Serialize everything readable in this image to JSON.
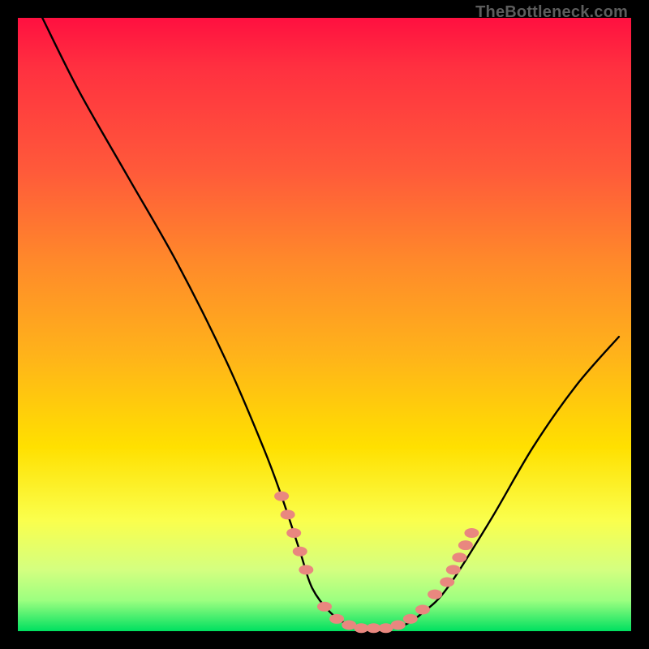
{
  "watermark": "TheBottleneck.com",
  "chart_data": {
    "type": "line",
    "title": "",
    "xlabel": "",
    "ylabel": "",
    "xlim": [
      0,
      100
    ],
    "ylim": [
      0,
      100
    ],
    "series": [
      {
        "name": "curve",
        "x": [
          4,
          10,
          18,
          26,
          34,
          40,
          43,
          46,
          48,
          51,
          54,
          57,
          60,
          63,
          66,
          70,
          77,
          84,
          91,
          98
        ],
        "y": [
          100,
          88,
          74,
          60,
          44,
          30,
          22,
          13,
          7,
          3,
          1,
          0.5,
          0.5,
          1,
          3,
          7,
          18,
          30,
          40,
          48
        ]
      }
    ],
    "markers": [
      {
        "name": "highlight-dots",
        "color": "#e9877f",
        "points": [
          {
            "x": 43,
            "y": 22
          },
          {
            "x": 44,
            "y": 19
          },
          {
            "x": 45,
            "y": 16
          },
          {
            "x": 46,
            "y": 13
          },
          {
            "x": 47,
            "y": 10
          },
          {
            "x": 50,
            "y": 4
          },
          {
            "x": 52,
            "y": 2
          },
          {
            "x": 54,
            "y": 1
          },
          {
            "x": 56,
            "y": 0.5
          },
          {
            "x": 58,
            "y": 0.5
          },
          {
            "x": 60,
            "y": 0.5
          },
          {
            "x": 62,
            "y": 1
          },
          {
            "x": 64,
            "y": 2
          },
          {
            "x": 66,
            "y": 3.5
          },
          {
            "x": 68,
            "y": 6
          },
          {
            "x": 70,
            "y": 8
          },
          {
            "x": 71,
            "y": 10
          },
          {
            "x": 72,
            "y": 12
          },
          {
            "x": 73,
            "y": 14
          },
          {
            "x": 74,
            "y": 16
          }
        ]
      }
    ]
  }
}
